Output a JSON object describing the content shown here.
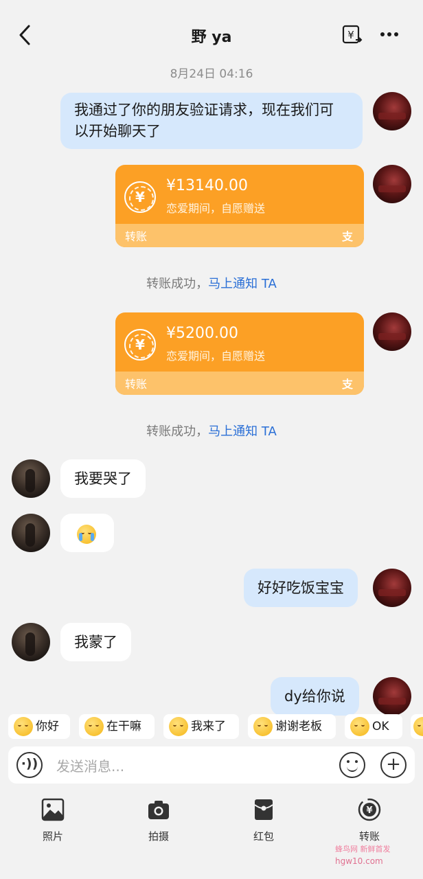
{
  "header": {
    "title": "野 ya",
    "back_icon": "chevron-left-icon",
    "transfer_icon": "yuan-transfer-icon",
    "more_icon": "more-dots-icon"
  },
  "timestamp": "8月24日 04:16",
  "messages": [
    {
      "from": "me",
      "text": "我通过了你的朋友验证请求，现在我们可以开始聊天了",
      "line1": "我通过了你的朋友验证请求，现在我们可",
      "line2": "以开始聊天了"
    },
    {
      "from": "me",
      "type": "transfer",
      "amount": "¥13140.00",
      "memo": "恋爱期间，自愿赠送",
      "footer": "转账",
      "brand_glyph": "支"
    },
    {
      "type": "system",
      "text": "转账成功，",
      "link": "马上通知 TA"
    },
    {
      "from": "me",
      "type": "transfer",
      "amount": "¥5200.00",
      "memo": "恋爱期间，自愿赠送",
      "footer": "转账",
      "brand_glyph": "支"
    },
    {
      "type": "system",
      "text": "转账成功，",
      "link": "马上通知 TA"
    },
    {
      "from": "her",
      "text": "我要哭了"
    },
    {
      "from": "her",
      "type": "emoji",
      "emoji": "crying-face"
    },
    {
      "from": "me",
      "text": "好好吃饭宝宝"
    },
    {
      "from": "her",
      "text": "我蒙了"
    },
    {
      "from": "me",
      "text": "dy给你说"
    }
  ],
  "quick_replies": [
    {
      "label": "你好",
      "emoji": "wave-face-icon"
    },
    {
      "label": "在干嘛",
      "emoji": "boss-face-icon"
    },
    {
      "label": "我来了",
      "emoji": "sunglasses-face-icon"
    },
    {
      "label": "谢谢老板",
      "emoji": "thanks-face-icon"
    },
    {
      "label": "OK",
      "emoji": "wink-face-icon"
    }
  ],
  "input": {
    "placeholder": "发送消息..."
  },
  "toolbar": [
    {
      "label": "照片",
      "icon": "photo-icon"
    },
    {
      "label": "拍摄",
      "icon": "camera-icon"
    },
    {
      "label": "红包",
      "icon": "red-packet-icon"
    },
    {
      "label": "转账",
      "icon": "transfer-icon"
    }
  ],
  "watermark": {
    "line1": "蜂鸟网 新鲜首发",
    "line2": "hgw10.com"
  },
  "colors": {
    "background": "#f2f2f2",
    "my_bubble": "#d6e8fc",
    "transfer_orange": "#fca025",
    "link_blue": "#2a6fd6"
  }
}
